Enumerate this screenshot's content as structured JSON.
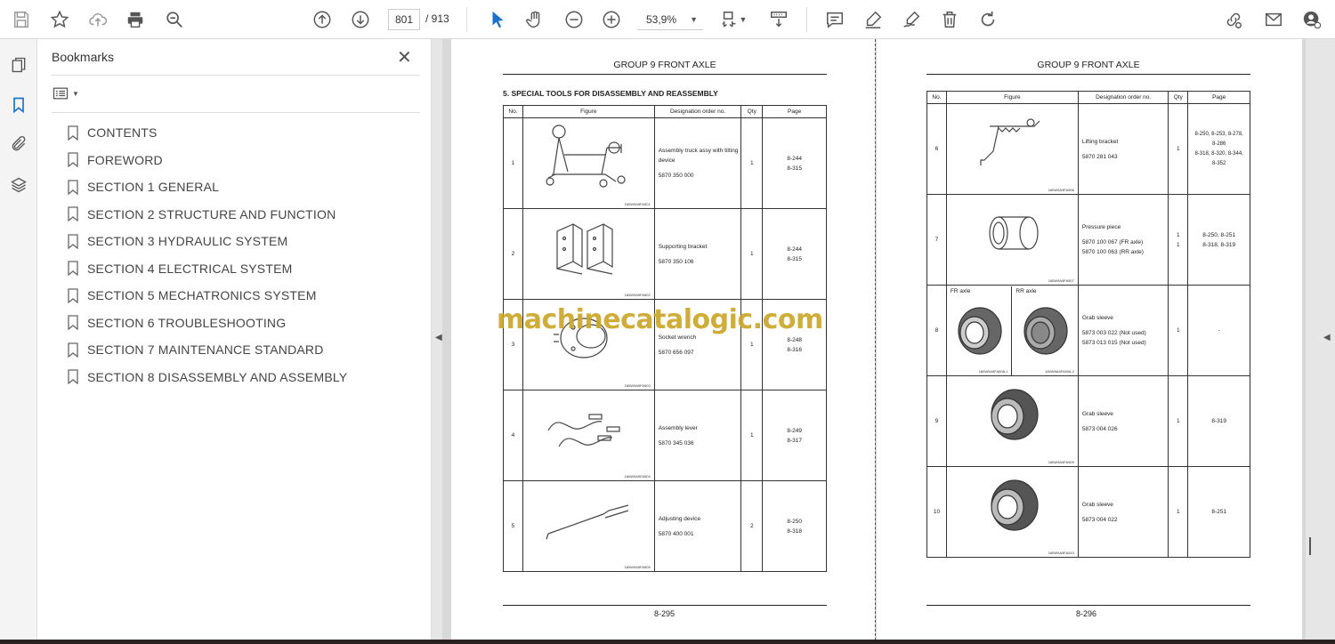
{
  "toolbar": {
    "current_page": "801",
    "total_pages": "/ 913",
    "zoom": "53,9%"
  },
  "panel": {
    "title": "Bookmarks",
    "close": "✕",
    "bookmarks": [
      "CONTENTS",
      "FOREWORD",
      "SECTION 1 GENERAL",
      "SECTION 2 STRUCTURE AND FUNCTION",
      "SECTION 3 HYDRAULIC SYSTEM",
      "SECTION 4 ELECTRICAL SYSTEM",
      "SECTION 5 MECHATRONICS SYSTEM",
      "SECTION 6 TROUBLESHOOTING",
      "SECTION 7 MAINTENANCE STANDARD",
      "SECTION 8 DISASSEMBLY AND ASSEMBLY"
    ]
  },
  "watermark": "machinecatalogic.com",
  "left_page": {
    "group_title": "GROUP 9 FRONT AXLE",
    "section_title": "5. SPECIAL TOOLS FOR DISASSEMBLY AND REASSEMBLY",
    "headers": {
      "no": "No.",
      "figure": "Figure",
      "designation": "Designation order no.",
      "qty": "Qty",
      "page": "Page"
    },
    "rows": [
      {
        "no": "1",
        "name": "Assembly truck assy with tilting device",
        "order": "5870 350 000",
        "qty": "1",
        "pages": "8-244\n8-315",
        "fig_code": "180W9A9FA501"
      },
      {
        "no": "2",
        "name": "Supporting bracket",
        "order": "5870 350 106",
        "qty": "1",
        "pages": "8-244\n8-315",
        "fig_code": "180W9A9FA502"
      },
      {
        "no": "3",
        "name": "Socket wrench",
        "order": "5870 656 097",
        "qty": "1",
        "pages": "8-248\n8-316",
        "fig_code": "180W9A9FA503"
      },
      {
        "no": "4",
        "name": "Assembly lever",
        "order": "5870 345 036",
        "qty": "1",
        "pages": "8-249\n8-317",
        "fig_code": "180W9A9FA504"
      },
      {
        "no": "5",
        "name": "Adjusting device",
        "order": "5870 400 001",
        "qty": "2",
        "pages": "8-250\n8-318",
        "fig_code": "180W9A9FA505"
      }
    ],
    "page_number": "8-295"
  },
  "right_page": {
    "group_title": "GROUP 9 FRONT AXLE",
    "headers": {
      "no": "No.",
      "figure": "Figure",
      "designation": "Designation order no.",
      "qty": "Qty",
      "page": "Page"
    },
    "rows": [
      {
        "no": "6",
        "name": "Lifting bracket",
        "order": "5870 281 043",
        "qty": "1",
        "pages": "8-250, 8-253, 8-278,\n8-286\n8-318, 8-320, 8-344,\n8-352",
        "fig_code": "180W9A9FA506"
      },
      {
        "no": "7",
        "name": "Pressure piece",
        "order": "5870 100 067 (FR axle)\n5870 100 063 (RR axle)",
        "qty": "1\n1",
        "pages": "8-250, 8-251\n8-318, 8-319",
        "fig_code": "180W9A9FA507"
      },
      {
        "no": "8",
        "name": "Grab sleeve",
        "order": "5873 003 022 (Not used)\n5873 013 015 (Not used)",
        "qty": "1",
        "pages": "-",
        "fig_code_fr": "180W9A9FA508-1",
        "fig_code_rr": "180W9A9FA508-2",
        "fr_label": "FR axle",
        "rr_label": "RR axle"
      },
      {
        "no": "9",
        "name": "Grab sleeve",
        "order": "5873 004 026",
        "qty": "1",
        "pages": "8-319",
        "fig_code": "180W9A9FA509"
      },
      {
        "no": "10",
        "name": "Grab sleeve",
        "order": "5873 004 022",
        "qty": "1",
        "pages": "8-251",
        "fig_code": "180W9A9FA510"
      }
    ],
    "page_number": "8-296"
  }
}
